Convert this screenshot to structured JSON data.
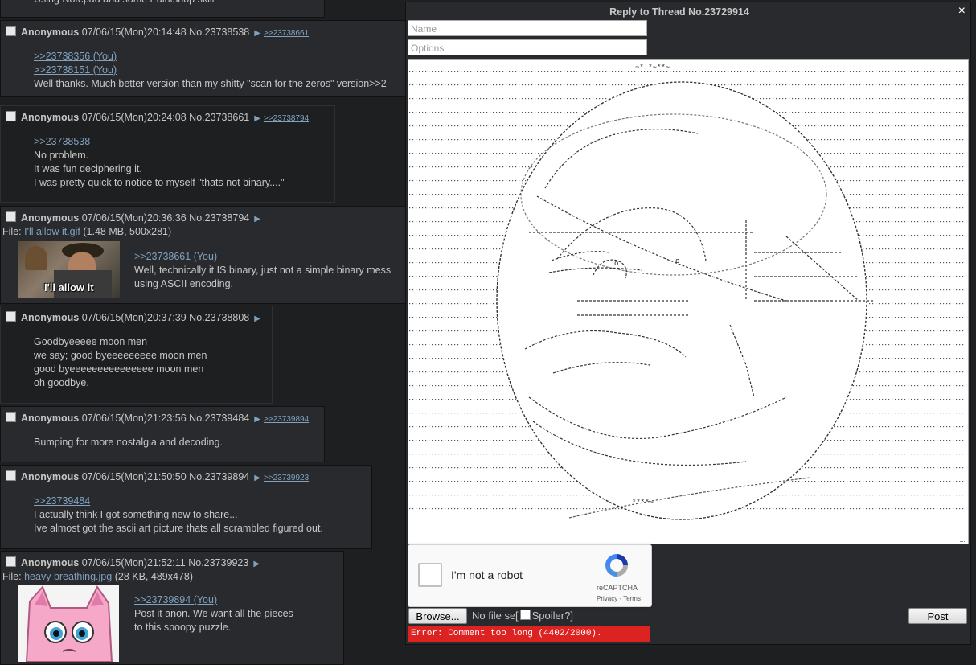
{
  "partial_text": "Using Notepad and some Paintshop skill",
  "posts": [
    {
      "name": "Anonymous",
      "datetime": "07/06/15(Mon)20:14:48",
      "postno": "No.23738538",
      "backlinks": [
        ">>23738661"
      ],
      "lines": [
        ">>23738356 (You)",
        ">>23738151 (You)",
        "Well thanks. Much better version than my shitty \"scan for the zeros\" version>>2"
      ]
    },
    {
      "name": "Anonymous",
      "datetime": "07/06/15(Mon)20:24:08",
      "postno": "No.23738661",
      "backlinks": [
        ">>23738794"
      ],
      "lines": [
        ">>23738538",
        "No problem.",
        "It was fun deciphering it.",
        "I was pretty quick to notice to myself \"thats not binary....\""
      ]
    },
    {
      "name": "Anonymous",
      "datetime": "07/06/15(Mon)20:36:36",
      "postno": "No.23738794",
      "backlinks": [],
      "file": {
        "label": "File:",
        "name": "I'll allow it.gif",
        "meta": "(1.48 MB, 500x281)",
        "thumb_caption": "I'll allow it"
      },
      "lines": [
        ">>23738661 (You)",
        "Well, technically it IS binary, just not a simple binary mess",
        "using ASCII encoding."
      ]
    },
    {
      "name": "Anonymous",
      "datetime": "07/06/15(Mon)20:37:39",
      "postno": "No.23738808",
      "backlinks": [],
      "lines": [
        "Goodbyeeeee moon men",
        "we say; good byeeeeeeeee moon men",
        "good byeeeeeeeeeeeeeee moon men",
        "oh goodbye."
      ]
    },
    {
      "name": "Anonymous",
      "datetime": "07/06/15(Mon)21:23:56",
      "postno": "No.23739484",
      "backlinks": [
        ">>23739894"
      ],
      "lines": [
        "Bumping for more nostalgia and decoding."
      ]
    },
    {
      "name": "Anonymous",
      "datetime": "07/06/15(Mon)21:50:50",
      "postno": "No.23739894",
      "backlinks": [
        ">>23739923"
      ],
      "lines": [
        ">>23739484",
        "I actually think I got something new to share...",
        "Ive almost got the ascii art picture thats all scrambled figured out."
      ]
    },
    {
      "name": "Anonymous",
      "datetime": "07/06/15(Mon)21:52:11",
      "postno": "No.23739923",
      "backlinks": [],
      "file": {
        "label": "File:",
        "name": "heavy breathing.jpg",
        "meta": "(28 KB, 489x478)"
      },
      "lines": [
        ">>23739894 (You)",
        "Post it anon. We want all the pieces",
        "to this spoopy puzzle."
      ]
    }
  ],
  "reply": {
    "title": "Reply to Thread No.23729914",
    "close_icon": "×",
    "name_placeholder": "Name",
    "options_placeholder": "Options",
    "captcha_label": "I'm not a robot",
    "captcha_brand": "reCAPTCHA",
    "captcha_links": "Privacy - Terms",
    "browse_label": "Browse...",
    "no_file": "No file selected.",
    "spoiler_open": "[",
    "spoiler_label": "Spoiler?]",
    "post_label": "Post",
    "error": "Error: Comment too long (4402/2000)."
  },
  "colors": {
    "bg": "#1d1f21",
    "post_bg": "#282a2e",
    "link": "#81a2be",
    "error": "#dd2222"
  }
}
